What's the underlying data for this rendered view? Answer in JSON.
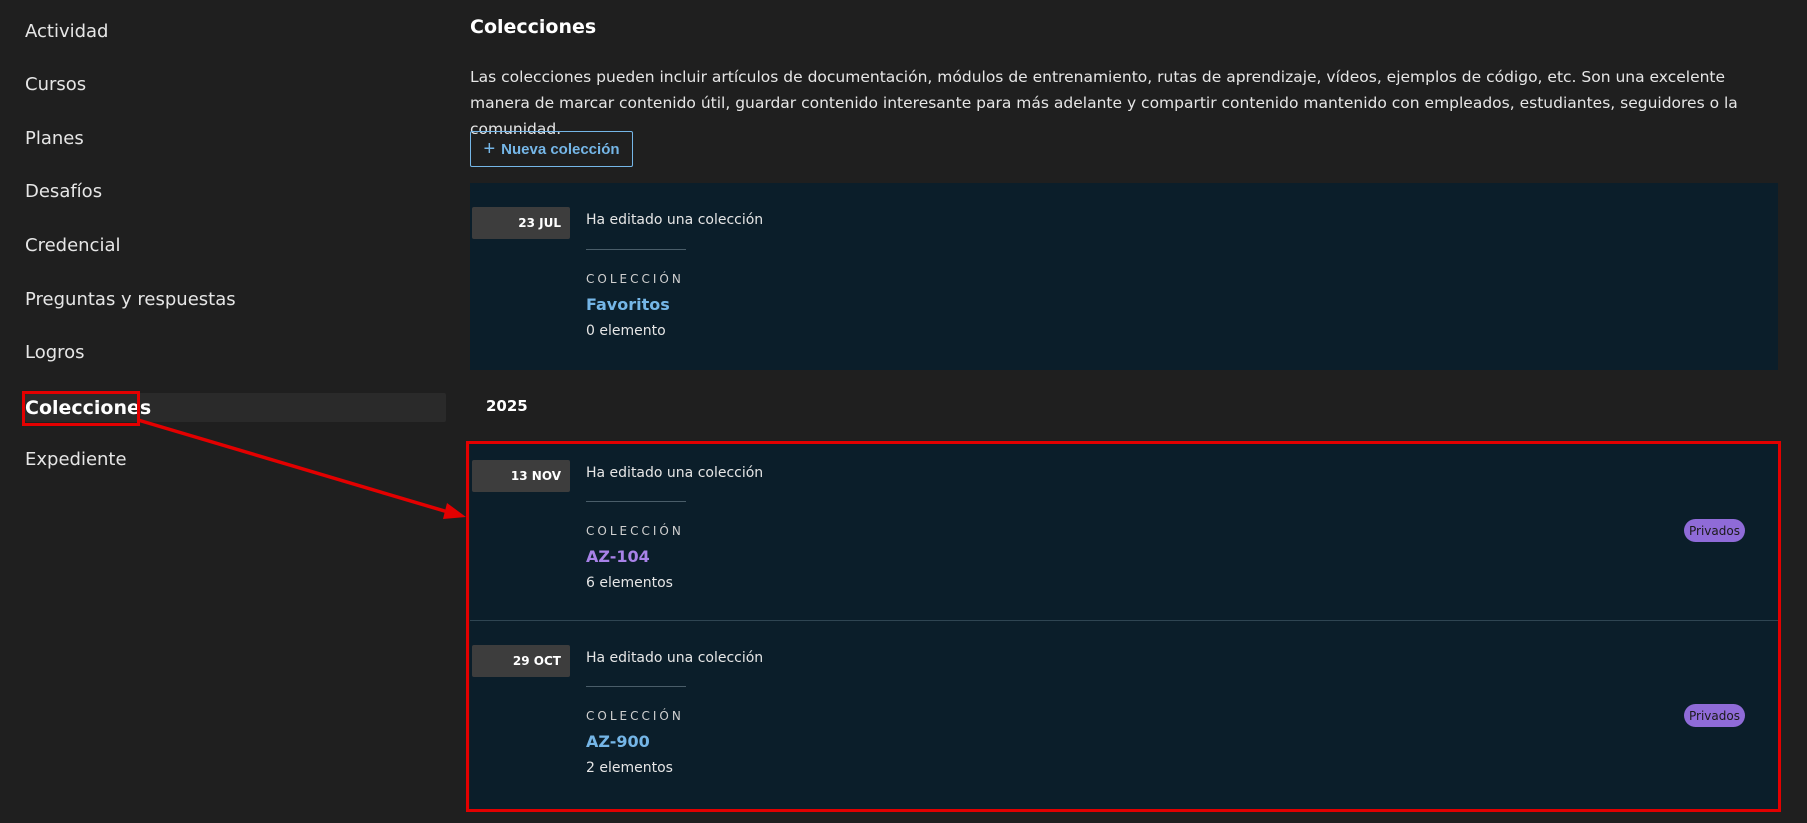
{
  "sidebar": {
    "items": [
      {
        "label": "Actividad"
      },
      {
        "label": "Cursos"
      },
      {
        "label": "Planes"
      },
      {
        "label": "Desafíos"
      },
      {
        "label": "Credencial"
      },
      {
        "label": "Preguntas y respuestas"
      },
      {
        "label": "Logros"
      },
      {
        "label": "Colecciones"
      },
      {
        "label": "Expediente"
      }
    ],
    "active_index": 7
  },
  "main": {
    "title": "Colecciones",
    "description": "Las colecciones pueden incluir artículos de documentación, módulos de entrenamiento, rutas de aprendizaje, vídeos, ejemplos de código, etc. Son una excelente manera de marcar contenido útil, guardar contenido interesante para más adelante y compartir contenido mantenido con empleados, estudiantes, seguidores o la comunidad.",
    "new_button_label": "Nueva colección",
    "new_button_icon": "plus-icon",
    "year_heading": "2025",
    "entries": [
      {
        "date": "23 JUL",
        "action": "Ha editado una colección",
        "kind": "COLECCIÓN",
        "name": "Favoritos",
        "count": "0 elemento",
        "link_color": "#75b6e7"
      },
      {
        "date": "13 NOV",
        "action": "Ha editado una colección",
        "kind": "COLECCIÓN",
        "name": "AZ-104",
        "count": "6 elementos",
        "badge": "Privados",
        "link_color": "#a882e8"
      },
      {
        "date": "29 OCT",
        "action": "Ha editado una colección",
        "kind": "COLECCIÓN",
        "name": "AZ-900",
        "count": "2 elementos",
        "badge": "Privados",
        "link_color": "#75b6e7"
      }
    ]
  },
  "colors": {
    "background": "#1f1f1f",
    "card": "#0b1e2a",
    "accent": "#75b6e7",
    "badge": "#8f6bd8",
    "annotation": "#e30000"
  }
}
